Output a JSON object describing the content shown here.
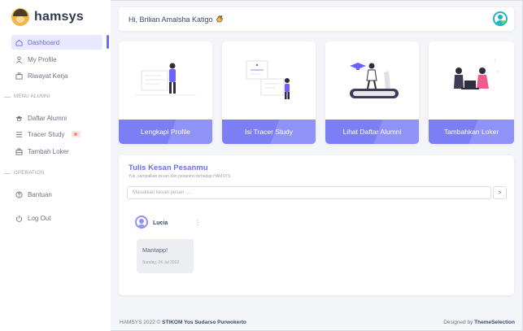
{
  "brand": {
    "name": "hamsys"
  },
  "sidebar": {
    "items": [
      {
        "label": "Dashboard",
        "icon": "home-icon"
      },
      {
        "label": "My Profile",
        "icon": "user-icon"
      },
      {
        "label": "Riwayat Kerja",
        "icon": "briefcase-icon"
      },
      {
        "label": "Daftar Alumni",
        "icon": "graduation-cap-icon"
      },
      {
        "label": "Tracer Study",
        "icon": "list-icon"
      },
      {
        "label": "Tambah Loker",
        "icon": "briefcase-plus-icon"
      },
      {
        "label": "Bantuan",
        "icon": "help-icon"
      },
      {
        "label": "Log Out",
        "icon": "power-icon"
      }
    ],
    "sections": {
      "alumni": "MENU ALUMNI",
      "operation": "OPERATION"
    }
  },
  "header": {
    "greeting": "Hi, Brilian Amalsha Katigo"
  },
  "cards": [
    {
      "label": "Lengkapi Profile"
    },
    {
      "label": "Isi Tracer Study"
    },
    {
      "label": "Lihat Daftar Alumni"
    },
    {
      "label": "Tambahkan Loker"
    }
  ],
  "kesan": {
    "title": "Tulis Kesan Pesanmu",
    "subtitle": "Yuk, sampaikan kesan dan pesanmu terhadap HAMSYS",
    "placeholder": "Masukkan kesan pesan .....",
    "send_glyph": ">",
    "comment": {
      "name": "Lucia",
      "message": "Mantapp!",
      "date": "Sunday, 24 Jul 2022"
    }
  },
  "footer": {
    "left_prefix": "HAMSYS 2022 ©",
    "left_org": "STIKOM Yos Sudarso Purwokerto",
    "right_prefix": "Designed by",
    "right_brand": "ThemeSelection"
  },
  "colors": {
    "accent": "#696cff",
    "card_label": "#7b7ef5",
    "active_bg": "#e8e9fd"
  }
}
